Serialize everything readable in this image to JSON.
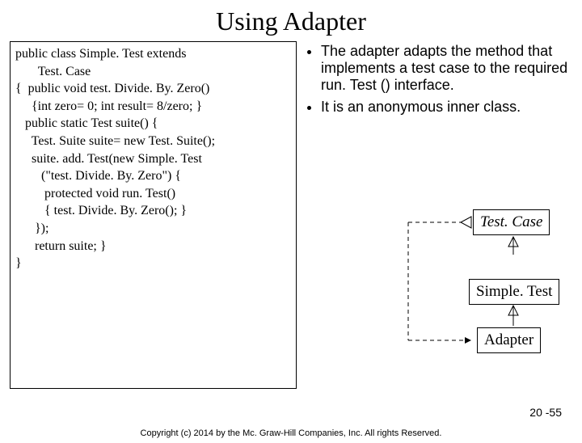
{
  "title": "Using Adapter",
  "code": {
    "l1": "public class Simple. Test extends",
    "l2": "       Test. Case",
    "l3": "{  public void test. Divide. By. Zero()",
    "l4": "     {int zero= 0; int result= 8/zero; }",
    "l5": "",
    "l6": "   public static Test suite() {",
    "l7": "     Test. Suite suite= new Test. Suite();",
    "l8": "     suite. add. Test(new Simple. Test",
    "l9": "        (\"test. Divide. By. Zero\") {",
    "l10": "         protected void run. Test()",
    "l11": "         { test. Divide. By. Zero(); }",
    "l12": "      });",
    "l13": "      return suite; }",
    "l14": "",
    "l15": "}"
  },
  "bullets": {
    "b1": "The adapter adapts the method that implements a test case to the required run. Test () interface.",
    "b2": "It is an anonymous inner class."
  },
  "diagram": {
    "top": "Test. Case",
    "mid": "Simple. Test",
    "bot": "Adapter"
  },
  "slidenum": "20 -55",
  "copyright": "Copyright (c) 2014 by the Mc. Graw-Hill Companies, Inc. All rights Reserved."
}
